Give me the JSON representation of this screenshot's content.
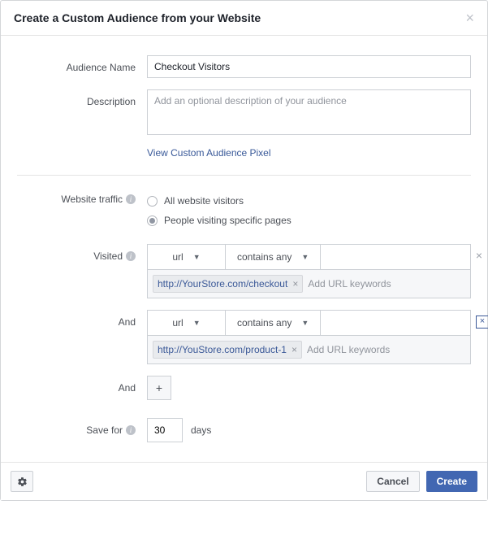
{
  "header": {
    "title": "Create a Custom Audience from your Website"
  },
  "form": {
    "audienceName": {
      "label": "Audience Name",
      "value": "Checkout Visitors"
    },
    "description": {
      "label": "Description",
      "placeholder": "Add an optional description of your audience"
    },
    "pixelLink": "View Custom Audience Pixel",
    "traffic": {
      "label": "Website traffic",
      "option1": "All website visitors",
      "option2": "People visiting specific pages"
    },
    "rules": [
      {
        "label": "Visited",
        "field": "url",
        "op": "contains any",
        "chip": "http://YourStore.com/checkout",
        "inputPlaceholder": "Add URL keywords",
        "removeStyle": "plain"
      },
      {
        "label": "And",
        "field": "url",
        "op": "contains any",
        "chip": "http://YouStore.com/product-1",
        "inputPlaceholder": "Add URL keywords",
        "removeStyle": "boxed"
      }
    ],
    "addLabel": "And",
    "saveFor": {
      "label": "Save for",
      "value": "30",
      "unit": "days"
    }
  },
  "footer": {
    "cancel": "Cancel",
    "create": "Create"
  }
}
